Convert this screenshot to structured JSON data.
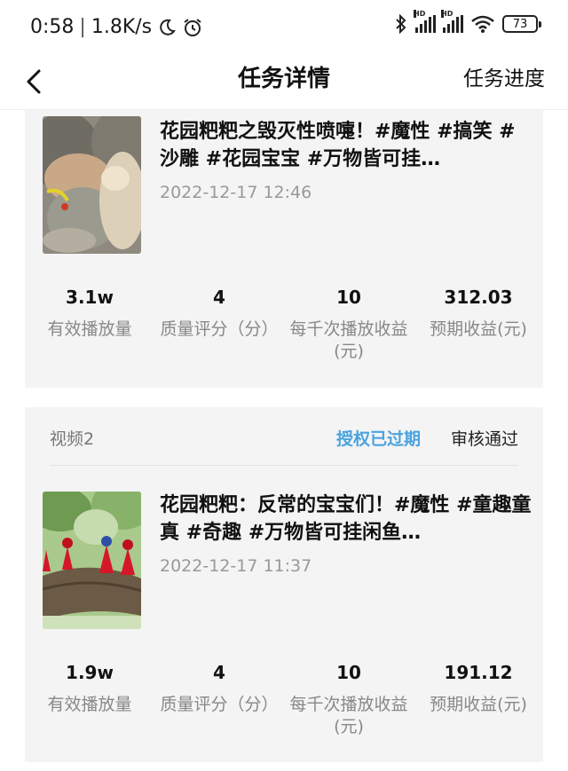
{
  "status_bar": {
    "time": "0:58",
    "separator": "|",
    "net_speed": "1.8K/s",
    "icons": [
      "moon-icon",
      "alarm-icon",
      "bluetooth-icon",
      "signal-hd-icon",
      "signal-hd-icon",
      "wifi-icon",
      "battery-icon"
    ],
    "signal_label": "HD",
    "battery": "73"
  },
  "nav": {
    "back_icon": "chevron-left-icon",
    "title": "任务详情",
    "action": "任务进度"
  },
  "videos": [
    {
      "title": "花园粑粑之毁灭性喷嚏！#魔性 #搞笑 #沙雕 #花园宝宝 #万物皆可挂…",
      "date": "2022-12-17 12:46",
      "stats": [
        {
          "value": "3.1w",
          "label": "有效播放量"
        },
        {
          "value": "4",
          "label": "质量评分（分）"
        },
        {
          "value": "10",
          "label": "每千次播放收益(元)"
        },
        {
          "value": "312.03",
          "label": "预期收益(元)"
        }
      ]
    },
    {
      "label": "视频2",
      "auth_status": "授权已过期",
      "review_status": "审核通过",
      "title": "花园粑粑：反常的宝宝们！#魔性 #童趣童真 #奇趣 #万物皆可挂闲鱼…",
      "date": "2022-12-17 11:37",
      "stats": [
        {
          "value": "1.9w",
          "label": "有效播放量"
        },
        {
          "value": "4",
          "label": "质量评分（分）"
        },
        {
          "value": "10",
          "label": "每千次播放收益(元)"
        },
        {
          "value": "191.12",
          "label": "预期收益(元)"
        }
      ]
    }
  ],
  "colors": {
    "accent_blue": "#4aa3df",
    "card_bg": "#f4f4f4",
    "muted_text": "#888888"
  }
}
